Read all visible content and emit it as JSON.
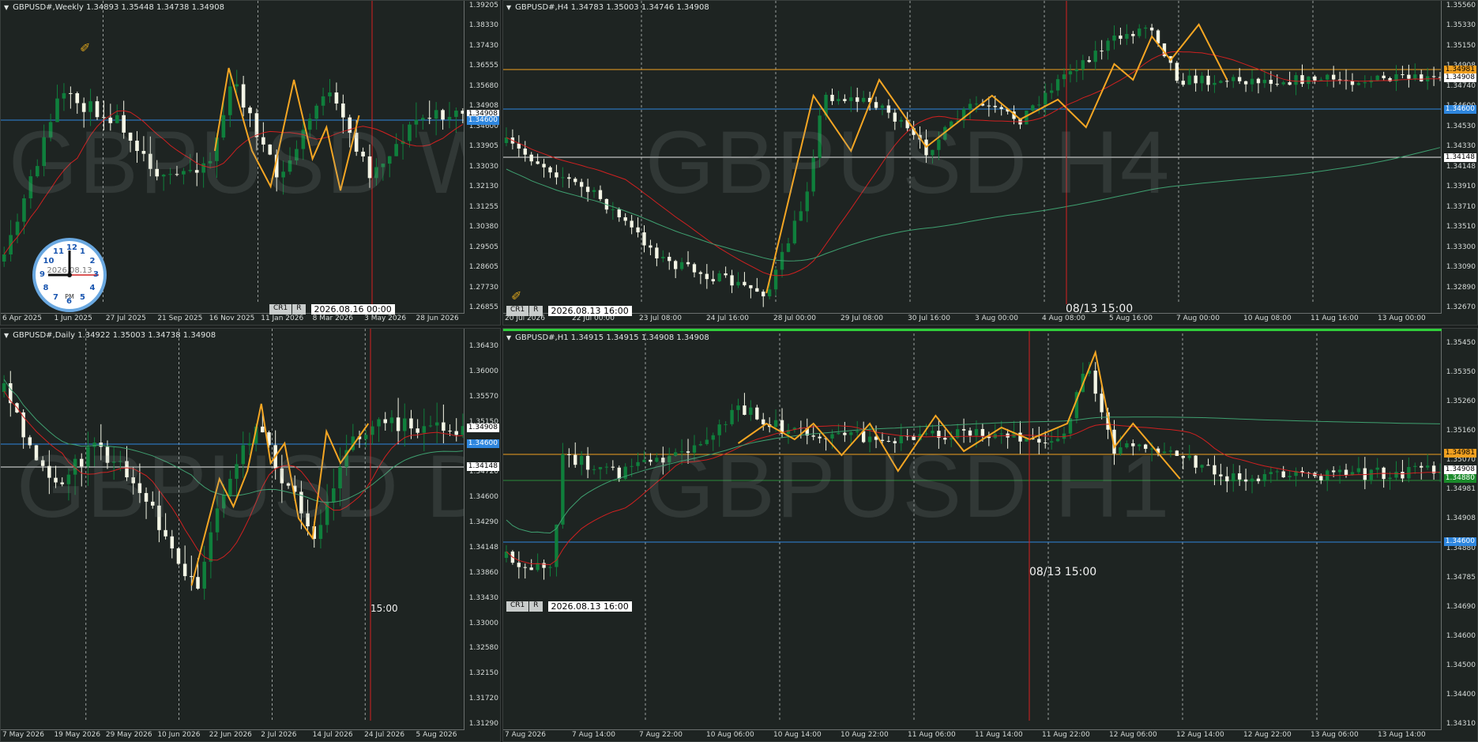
{
  "colors": {
    "bull": "#0f7f3c",
    "bear": "#f4f6e6",
    "zigzag": "#f5a623",
    "ma_red": "#d02020",
    "ma_green": "#3fa070",
    "blue_line": "#2e86de",
    "orange_line": "#f0a020",
    "white_line": "#e8e8e8",
    "vline_red": "#d62020"
  },
  "tool_icon": "crosshair-cursor-icon",
  "weekly": {
    "info": "GBPUSD#,Weekly  1.34893 1.35448 1.34738 1.34908",
    "watermark": "GBPUSD W1",
    "y_ticks": [
      "1.39205",
      "1.38330",
      "1.37430",
      "1.36555",
      "1.35680",
      "1.34908",
      "1.34600",
      "1.33905",
      "1.33030",
      "1.32130",
      "1.31255",
      "1.30380",
      "1.29505",
      "1.28605",
      "1.27730",
      "1.26855"
    ],
    "x_ticks": [
      "6 Apr 2025",
      "1 Jun 2025",
      "27 Jul 2025",
      "21 Sep 2025",
      "16 Nov 2025",
      "11 Jan 2026",
      "8 Mar 2026",
      "3 May 2026",
      "28 Jun 2026"
    ],
    "price_tags": {
      "blue": "1.34600",
      "current": "1.34908"
    },
    "cr": [
      "CR1",
      "R"
    ],
    "date_box": "2026.08.16 00:00",
    "clock": {
      "date": "2026.08.13",
      "ampm": "PM",
      "numbers": [
        "12",
        "1",
        "2",
        "3",
        "4",
        "5",
        "6",
        "7",
        "8",
        "9",
        "10",
        "11"
      ]
    }
  },
  "h4": {
    "info": "GBPUSD#,H4  1.34783 1.35003 1.34746 1.34908",
    "watermark": "GBPUSD H4",
    "y_ticks": [
      "1.35560",
      "1.35330",
      "1.35150",
      "1.34908",
      "1.34740",
      "1.34600",
      "1.34530",
      "1.34330",
      "1.34148",
      "1.33910",
      "1.33710",
      "1.33510",
      "1.33300",
      "1.33090",
      "1.32890",
      "1.32670"
    ],
    "x_ticks": [
      "20 Jul 2026",
      "22 Jul 00:00",
      "23 Jul 08:00",
      "24 Jul 16:00",
      "28 Jul 00:00",
      "29 Jul 08:00",
      "30 Jul 16:00",
      "3 Aug 00:00",
      "4 Aug 08:00",
      "5 Aug 16:00",
      "7 Aug 00:00",
      "10 Aug 08:00",
      "11 Aug 16:00",
      "13 Aug 00:00"
    ],
    "price_tags": {
      "orange": "1.34981",
      "current": "1.34908",
      "blue": "1.34600",
      "white": "1.34148"
    },
    "cr": [
      "CR1",
      "R"
    ],
    "date_box": "2026.08.13 16:00",
    "timestamp": "08/13 15:00"
  },
  "daily": {
    "info": "GBPUSD#,Daily  1.34922 1.35003 1.34738 1.34908",
    "watermark": "GBPUSD D1",
    "y_ticks": [
      "1.36430",
      "1.36000",
      "1.35570",
      "1.35150",
      "1.34908",
      "1.34720",
      "1.34600",
      "1.34290",
      "1.34148",
      "1.33860",
      "1.33430",
      "1.33000",
      "1.32580",
      "1.32150",
      "1.31720",
      "1.31290"
    ],
    "x_ticks": [
      "7 May 2026",
      "19 May 2026",
      "29 May 2026",
      "10 Jun 2026",
      "22 Jun 2026",
      "2 Jul 2026",
      "14 Jul 2026",
      "24 Jul 2026",
      "5 Aug 2026"
    ],
    "price_tags": {
      "current": "1.34908",
      "blue": "1.34600",
      "white": "1.34148"
    },
    "timestamp": "15:00"
  },
  "h1": {
    "info": "GBPUSD#,H1  1.34915 1.34915 1.34908 1.34908",
    "watermark": "GBPUSD H1",
    "y_ticks": [
      "1.35450",
      "1.35350",
      "1.35260",
      "1.35160",
      "1.35070",
      "1.34981",
      "1.34908",
      "1.34880",
      "1.34785",
      "1.34690",
      "1.34600",
      "1.34500",
      "1.34400",
      "1.34310"
    ],
    "x_ticks": [
      "7 Aug 2026",
      "7 Aug 14:00",
      "7 Aug 22:00",
      "10 Aug 06:00",
      "10 Aug 14:00",
      "10 Aug 22:00",
      "11 Aug 06:00",
      "11 Aug 14:00",
      "11 Aug 22:00",
      "12 Aug 06:00",
      "12 Aug 14:00",
      "12 Aug 22:00",
      "13 Aug 06:00",
      "13 Aug 14:00"
    ],
    "price_tags": {
      "orange": "1.34981",
      "current": "1.34908",
      "green": "1.34880",
      "blue": "1.34600"
    },
    "cr": [
      "CR1",
      "R"
    ],
    "date_box": "2026.08.13 16:00",
    "timestamp": "08/13 15:00"
  }
}
